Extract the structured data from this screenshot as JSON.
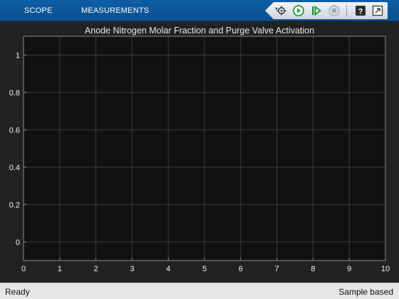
{
  "toolstrip": {
    "tabs": [
      {
        "label": "SCOPE"
      },
      {
        "label": "MEASUREMENTS"
      }
    ],
    "buttons": [
      {
        "icon": "signal-selector-icon"
      },
      {
        "icon": "run-icon"
      },
      {
        "icon": "step-forward-icon"
      },
      {
        "icon": "stop-icon"
      },
      {
        "icon": "help-icon"
      },
      {
        "icon": "undock-icon"
      }
    ],
    "accent": "#0a4f8e"
  },
  "plot": {
    "title": "Anode Nitrogen Molar Fraction and Purge Valve Activation"
  },
  "chart_data": {
    "type": "line",
    "title": "Anode Nitrogen Molar Fraction and Purge Valve Activation",
    "xlabel": "",
    "ylabel": "",
    "xlim": [
      0,
      10
    ],
    "ylim": [
      -0.1,
      1.1
    ],
    "x_ticks": [
      0,
      1,
      2,
      3,
      4,
      5,
      6,
      7,
      8,
      9,
      10
    ],
    "y_ticks": [
      0,
      0.2,
      0.4,
      0.6,
      0.8,
      1
    ],
    "x_tick_labels": [
      "0",
      "1",
      "2",
      "3",
      "4",
      "5",
      "6",
      "7",
      "8",
      "9",
      "10"
    ],
    "y_tick_labels": [
      "0",
      "0.2",
      "0.4",
      "0.6",
      "0.8",
      "1"
    ],
    "grid": true,
    "series": [],
    "colors": {
      "background": "#111111",
      "grid": "#3c3c3c",
      "axis": "#8a8a8a"
    }
  },
  "status": {
    "left": "Ready",
    "right": "Sample based"
  }
}
